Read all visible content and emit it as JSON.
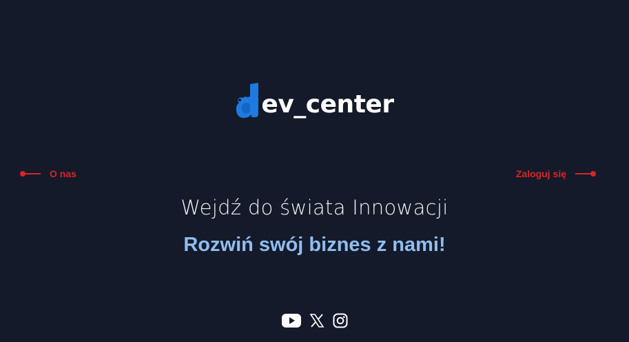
{
  "logo": {
    "mark_letter": "d",
    "text": "ev_center",
    "mark_color": "#1e7ae0"
  },
  "nav": {
    "left_label": "O nas",
    "right_label": "Zaloguj się",
    "accent_color": "#d92525"
  },
  "hero": {
    "headline": "Wejdź do świata Innowacji",
    "subheadline": "Rozwiń swój biznes z nami!"
  },
  "socials": [
    {
      "name": "youtube-icon"
    },
    {
      "name": "x-icon"
    },
    {
      "name": "instagram-icon"
    }
  ],
  "colors": {
    "background": "#141a29",
    "subheadline": "#8fbdf0"
  }
}
